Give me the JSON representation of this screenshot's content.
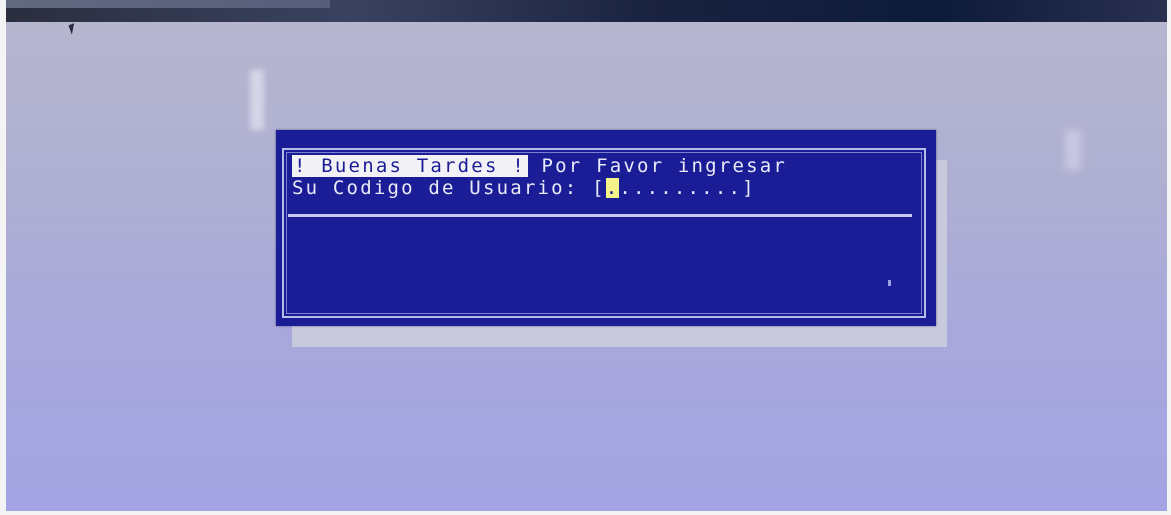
{
  "dialog": {
    "greeting": "! Buenas Tardes !",
    "prompt_suffix": " Por Favor ingresar",
    "code_label": "Su Codigo de Usuario: ",
    "field_open": "[",
    "field_caret": ".",
    "field_rest": ".........",
    "field_close": "]"
  },
  "colors": {
    "dialog_background": "#1b1d97",
    "text": "#e8eaf8",
    "highlight_background": "#f2f2f6",
    "caret": "#f6f28a"
  }
}
